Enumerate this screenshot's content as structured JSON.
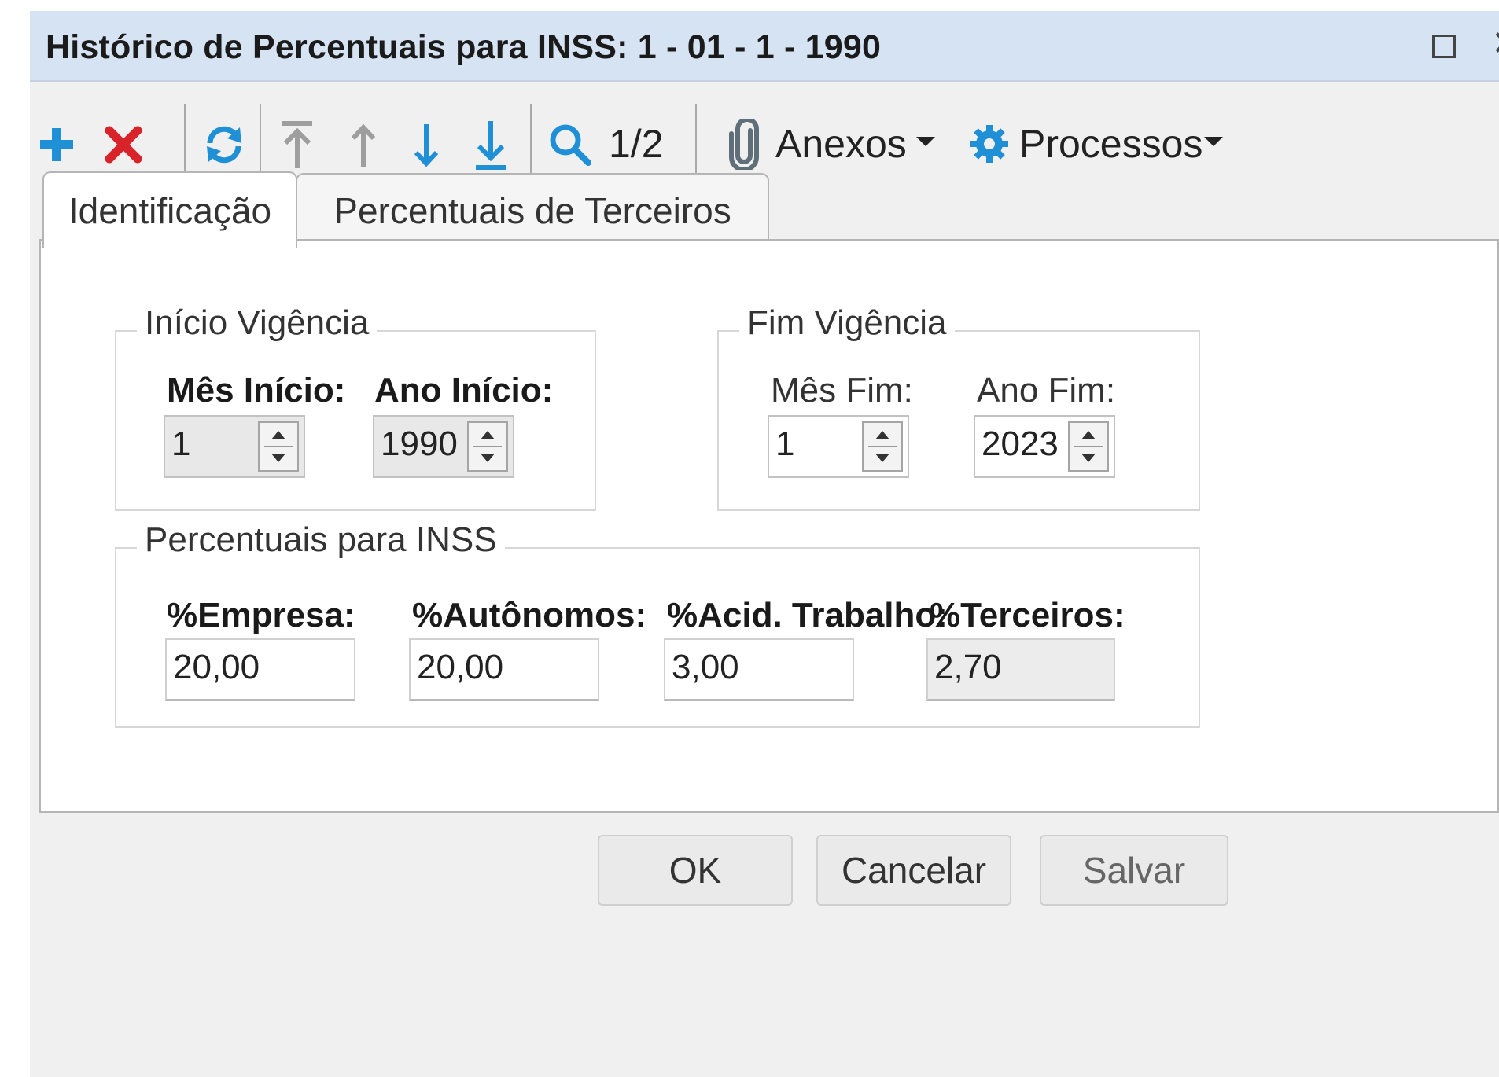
{
  "window": {
    "title": "Histórico de Percentuais para INSS: 1 - 01 - 1 - 1990"
  },
  "toolbar": {
    "record_position": "1/2",
    "anexos_label": "Anexos",
    "processos_label": "Processos",
    "colors": {
      "add": "#1f8fd6",
      "delete": "#d9232a",
      "nav_blue": "#1f8fd6",
      "nav_disabled": "#9e9e9e"
    }
  },
  "tabs": [
    {
      "label": "Identificação",
      "active": true
    },
    {
      "label": "Percentuais de Terceiros",
      "active": false
    }
  ],
  "inicio_vigencia": {
    "title": "Início Vigência",
    "mes_label": "Mês Início:",
    "mes_value": "1",
    "ano_label": "Ano Início:",
    "ano_value": "1990"
  },
  "fim_vigencia": {
    "title": "Fim Vigência",
    "mes_label": "Mês Fim:",
    "mes_value": "1",
    "ano_label": "Ano Fim:",
    "ano_value": "2023"
  },
  "percentuais": {
    "title": "Percentuais para INSS",
    "empresa_label": "%Empresa:",
    "empresa_value": "20,00",
    "autonomos_label": "%Autônomos:",
    "autonomos_value": "20,00",
    "acid_label": "%Acid. Trabalho:",
    "acid_value": "3,00",
    "terceiros_label": "%Terceiros:",
    "terceiros_value": "2,70"
  },
  "buttons": {
    "ok": "OK",
    "cancelar": "Cancelar",
    "salvar": "Salvar"
  }
}
